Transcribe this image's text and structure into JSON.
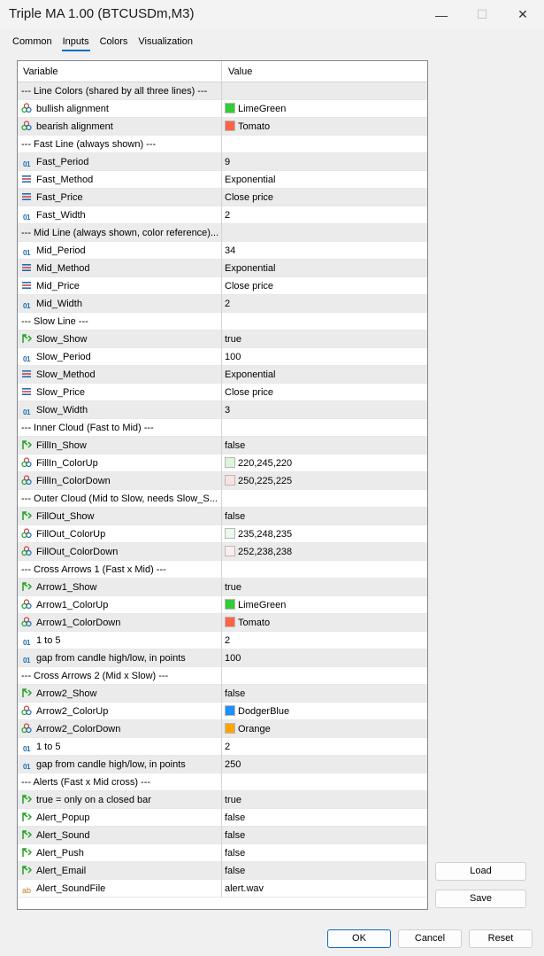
{
  "window": {
    "title": "Triple MA 1.00 (BTCUSDm,M3)",
    "minimize_glyph": "—",
    "maximize_glyph": "☐",
    "close_glyph": "✕"
  },
  "tabs": [
    {
      "label": "Common",
      "active": false
    },
    {
      "label": "Inputs",
      "active": true
    },
    {
      "label": "Colors",
      "active": false
    },
    {
      "label": "Visualization",
      "active": false
    }
  ],
  "grid": {
    "headers": {
      "variable": "Variable",
      "value": "Value"
    },
    "rows": [
      {
        "type": "section",
        "name": "--- Line Colors (shared by all three lines) ---",
        "value": ""
      },
      {
        "type": "color",
        "name": "bullish alignment",
        "value": "LimeGreen",
        "swatch": "#32cd32"
      },
      {
        "type": "color",
        "name": "bearish alignment",
        "value": "Tomato",
        "swatch": "#ff6347"
      },
      {
        "type": "section",
        "name": "--- Fast Line (always shown) ---",
        "value": ""
      },
      {
        "type": "int",
        "name": "Fast_Period",
        "value": "9"
      },
      {
        "type": "enum",
        "name": "Fast_Method",
        "value": "Exponential"
      },
      {
        "type": "enum",
        "name": "Fast_Price",
        "value": "Close price"
      },
      {
        "type": "int",
        "name": "Fast_Width",
        "value": "2"
      },
      {
        "type": "section",
        "name": "--- Mid Line (always shown, color reference)...",
        "value": ""
      },
      {
        "type": "int",
        "name": "Mid_Period",
        "value": "34"
      },
      {
        "type": "enum",
        "name": "Mid_Method",
        "value": "Exponential"
      },
      {
        "type": "enum",
        "name": "Mid_Price",
        "value": "Close price"
      },
      {
        "type": "int",
        "name": "Mid_Width",
        "value": "2"
      },
      {
        "type": "section",
        "name": "--- Slow Line ---",
        "value": ""
      },
      {
        "type": "bool",
        "name": "Slow_Show",
        "value": "true"
      },
      {
        "type": "int",
        "name": "Slow_Period",
        "value": "100"
      },
      {
        "type": "enum",
        "name": "Slow_Method",
        "value": "Exponential"
      },
      {
        "type": "enum",
        "name": "Slow_Price",
        "value": "Close price"
      },
      {
        "type": "int",
        "name": "Slow_Width",
        "value": "3"
      },
      {
        "type": "section",
        "name": "--- Inner Cloud (Fast to Mid) ---",
        "value": ""
      },
      {
        "type": "bool",
        "name": "FillIn_Show",
        "value": "false"
      },
      {
        "type": "color",
        "name": "FillIn_ColorUp",
        "value": "220,245,220",
        "swatch": "#dcf5dc"
      },
      {
        "type": "color",
        "name": "FillIn_ColorDown",
        "value": "250,225,225",
        "swatch": "#fae1e1"
      },
      {
        "type": "section",
        "name": "--- Outer Cloud (Mid to Slow, needs Slow_S...",
        "value": ""
      },
      {
        "type": "bool",
        "name": "FillOut_Show",
        "value": "false"
      },
      {
        "type": "color",
        "name": "FillOut_ColorUp",
        "value": "235,248,235",
        "swatch": "#ebf8eb"
      },
      {
        "type": "color",
        "name": "FillOut_ColorDown",
        "value": "252,238,238",
        "swatch": "#fceeee"
      },
      {
        "type": "section",
        "name": "--- Cross Arrows 1 (Fast x Mid) ---",
        "value": ""
      },
      {
        "type": "bool",
        "name": "Arrow1_Show",
        "value": "true"
      },
      {
        "type": "color",
        "name": "Arrow1_ColorUp",
        "value": "LimeGreen",
        "swatch": "#32cd32"
      },
      {
        "type": "color",
        "name": "Arrow1_ColorDown",
        "value": "Tomato",
        "swatch": "#ff6347"
      },
      {
        "type": "int",
        "name": "1 to 5",
        "value": "2"
      },
      {
        "type": "int",
        "name": "gap from candle high/low, in points",
        "value": "100"
      },
      {
        "type": "section",
        "name": "--- Cross Arrows 2 (Mid x Slow) ---",
        "value": ""
      },
      {
        "type": "bool",
        "name": "Arrow2_Show",
        "value": "false"
      },
      {
        "type": "color",
        "name": "Arrow2_ColorUp",
        "value": "DodgerBlue",
        "swatch": "#1e90ff"
      },
      {
        "type": "color",
        "name": "Arrow2_ColorDown",
        "value": "Orange",
        "swatch": "#ffa500"
      },
      {
        "type": "int",
        "name": "1 to 5",
        "value": "2"
      },
      {
        "type": "int",
        "name": "gap from candle high/low, in points",
        "value": "250"
      },
      {
        "type": "section",
        "name": "--- Alerts (Fast x Mid cross) ---",
        "value": ""
      },
      {
        "type": "bool",
        "name": "true = only on a closed bar",
        "value": "true"
      },
      {
        "type": "bool",
        "name": "Alert_Popup",
        "value": "false"
      },
      {
        "type": "bool",
        "name": "Alert_Sound",
        "value": "false"
      },
      {
        "type": "bool",
        "name": "Alert_Push",
        "value": "false"
      },
      {
        "type": "bool",
        "name": "Alert_Email",
        "value": "false"
      },
      {
        "type": "string",
        "name": "Alert_SoundFile",
        "value": "alert.wav"
      }
    ]
  },
  "buttons": {
    "load": "Load",
    "save": "Save",
    "ok": "OK",
    "cancel": "Cancel",
    "reset": "Reset"
  },
  "icons": {
    "int": "01",
    "string": "ab"
  }
}
